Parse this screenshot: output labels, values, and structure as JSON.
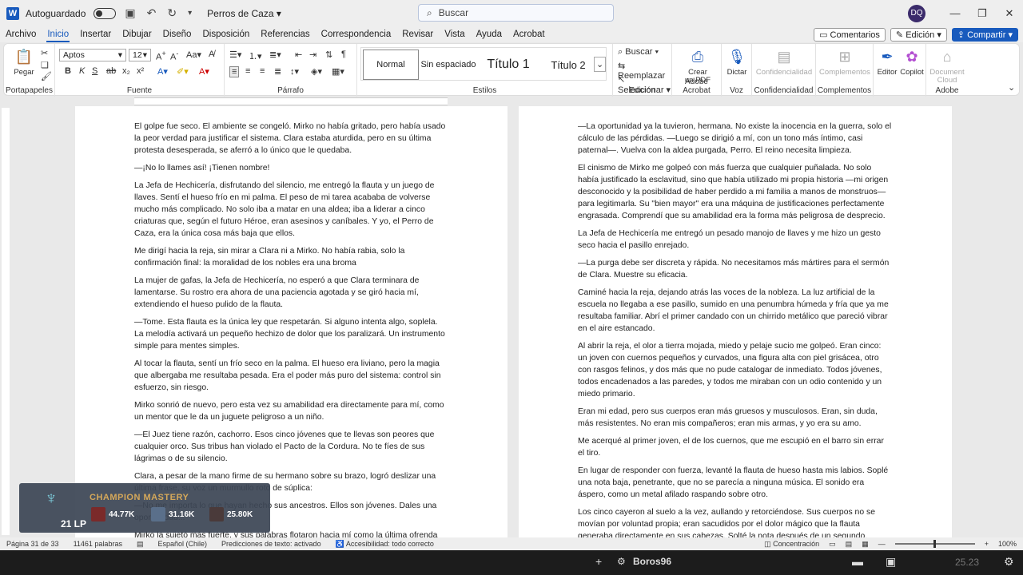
{
  "titlebar": {
    "autosave_label": "Autoguardado",
    "document_name": "Perros de Caza",
    "search_placeholder": "Buscar",
    "user_initials": "DQ"
  },
  "menu": {
    "tabs": [
      "Archivo",
      "Inicio",
      "Insertar",
      "Dibujar",
      "Diseño",
      "Disposición",
      "Referencias",
      "Correspondencia",
      "Revisar",
      "Vista",
      "Ayuda",
      "Acrobat"
    ],
    "active": "Inicio",
    "comments_label": "Comentarios",
    "edit_label": "Edición",
    "share_label": "Compartir"
  },
  "ribbon": {
    "clipboard": {
      "paste_label": "Pegar",
      "group_label": "Portapapeles"
    },
    "font": {
      "font_name": "Aptos",
      "font_size": "12",
      "group_label": "Fuente"
    },
    "paragraph": {
      "group_label": "Párrafo"
    },
    "styles": {
      "items": [
        "Normal",
        "Sin espaciado",
        "Título 1",
        "Título 2"
      ],
      "group_label": "Estilos"
    },
    "editing": {
      "find_label": "Buscar",
      "replace_label": "Reemplazar",
      "select_label": "Seleccionar",
      "group_label": "Edición"
    },
    "acrobat": {
      "create_pdf_line1": "Crear",
      "create_pdf_line2": "un PDF",
      "group_label": "Adobe Acrobat"
    },
    "voice": {
      "dictate_label": "Dictar",
      "group_label": "Voz"
    },
    "sensitivity": {
      "label": "Confidencialidad",
      "group_label": "Confidencialidad"
    },
    "addins": {
      "label": "Complementos",
      "group_label": "Complementos"
    },
    "editor_label": "Editor",
    "copilot_label": "Copilot",
    "document_cloud_line1": "Document",
    "document_cloud_line2": "Cloud",
    "adobe_group_label": "Adobe"
  },
  "page_left": [
    "El golpe fue seco. El ambiente se congeló. Mirko no había gritado, pero había usado la peor verdad para justificar el sistema. Clara estaba aturdida, pero en su última protesta desesperada, se aferró a lo único que le quedaba.",
    "—¡No lo llames así! ¡Tienen nombre!",
    "La Jefa de Hechicería, disfrutando del silencio, me entregó la flauta y un juego de llaves. Sentí el hueso frío en mi palma. El peso de mi tarea acababa de volverse mucho más complicado. No solo iba a matar en una aldea; iba a liderar a cinco criaturas que, según el futuro Héroe, eran asesinos y caníbales. Y yo, el Perro de Caza, era la única cosa más baja que ellos.",
    "Me dirigí hacia la reja, sin mirar a Clara ni a Mirko. No había rabia, solo la confirmación final: la moralidad de los nobles era una broma",
    "La mujer de gafas, la Jefa de Hechicería, no esperó a que Clara terminara de lamentarse. Su rostro era ahora de una paciencia agotada y se giró hacia mí, extendiendo el hueso pulido de la flauta.",
    "—Tome. Esta flauta es la única ley que respetarán. Si alguno intenta algo, soplela. La melodía activará un pequeño hechizo de dolor que los paralizará. Un instrumento simple para mentes simples.",
    "Al tocar la flauta, sentí un frío seco en la palma. El hueso era liviano, pero la magia que albergaba me resultaba pesada. Era el poder más puro del sistema: control sin esfuerzo, sin riesgo.",
    "Mirko sonrió de nuevo, pero esta vez su amabilidad era directamente para mí, como un mentor que le da un juguete peligroso a un niño.",
    "—El Juez tiene razón, cachorro. Esos cinco jóvenes que te llevas son peores que cualquier orco. Sus tribus han violado el Pacto de la Cordura. No te fíes de sus lágrimas o de su silencio.",
    "Clara, a pesar de la mano firme de su hermano sobre su brazo, logró deslizar una última frase, su voz un murmullo roto de súplica:",
    "—No me importa lo que hayan hecho sus ancestros. Ellos son jóvenes. Dales una oportunidad...",
    "Mirko la sujetó más fuerte, y sus palabras flotaron hacia mí como la última ofrenda de"
  ],
  "page_right": [
    "—La oportunidad ya la tuvieron, hermana. No existe la inocencia en la guerra, solo el cálculo de las pérdidas. —Luego se dirigió a mí, con un tono más íntimo, casi paternal—. Vuelva con la aldea purgada, Perro. El reino necesita limpieza.",
    "El cinismo de Mirko me golpeó con más fuerza que cualquier puñalada. No solo había justificado la esclavitud, sino que había utilizado mi propia historia —mi origen desconocido y la posibilidad de haber perdido a mi familia a manos de monstruos— para legitimarla. Su \"bien mayor\" era una máquina de justificaciones perfectamente engrasada. Comprendí que su amabilidad era la forma más peligrosa de desprecio.",
    "La Jefa de Hechicería me entregó un pesado manojo de llaves y me hizo un gesto seco hacia el pasillo enrejado.",
    "—La purga debe ser discreta y rápida. No necesitamos más mártires para el sermón de Clara. Muestre su eficacia.",
    "Caminé hacia la reja, dejando atrás las voces de la nobleza. La luz artificial de la escuela no llegaba a ese pasillo, sumido en una penumbra húmeda y fría que ya me resultaba familiar. Abrí el primer candado con un chirrido metálico que pareció vibrar en el aire estancado.",
    "Al abrir la reja, el olor a tierra mojada, miedo y pelaje sucio me golpeó. Eran cinco: un joven con cuernos pequeños y curvados, una figura alta con piel grisácea, otro con rasgos felinos, y dos más que no pude catalogar de inmediato. Todos jóvenes, todos encadenados a las paredes, y todos me miraban con un odio contenido y un miedo primario.",
    "Eran mi edad, pero sus cuerpos eran más gruesos y musculosos. Eran, sin duda, más resistentes. No eran mis compañeros; eran mis armas, y yo era su amo.",
    "Me acerqué al primer joven, el de los cuernos, que me escupió en el barro sin errar el tiro.",
    "En lugar de responder con fuerza, levanté la flauta de hueso hasta mis labios. Soplé una nota baja, penetrante, que no se parecía a ninguna música. El sonido era áspero, como un metal afilado raspando sobre otro.",
    "Los cinco cayeron al suelo a la vez, aullando y retorciéndose. Sus cuerpos no se movían por voluntad propia; eran sacudidos por el dolor mágico que la flauta generaba directamente en sus cabezas. Solté la nota después de un segundo."
  ],
  "statusbar": {
    "page": "Página 31 de 33",
    "words": "11461 palabras",
    "language": "Español (Chile)",
    "predictions": "Predicciones de texto: activado",
    "accessibility": "Accesibilidad: todo correcto",
    "focus": "Concentración",
    "zoom": "100%"
  },
  "overlay": {
    "title": "CHAMPION MASTERY",
    "lp": "21 LP",
    "stats": [
      "44.77K",
      "31.16K",
      "25.80K"
    ],
    "player": "Boros96"
  },
  "taskbar": {
    "time": "25.23"
  }
}
